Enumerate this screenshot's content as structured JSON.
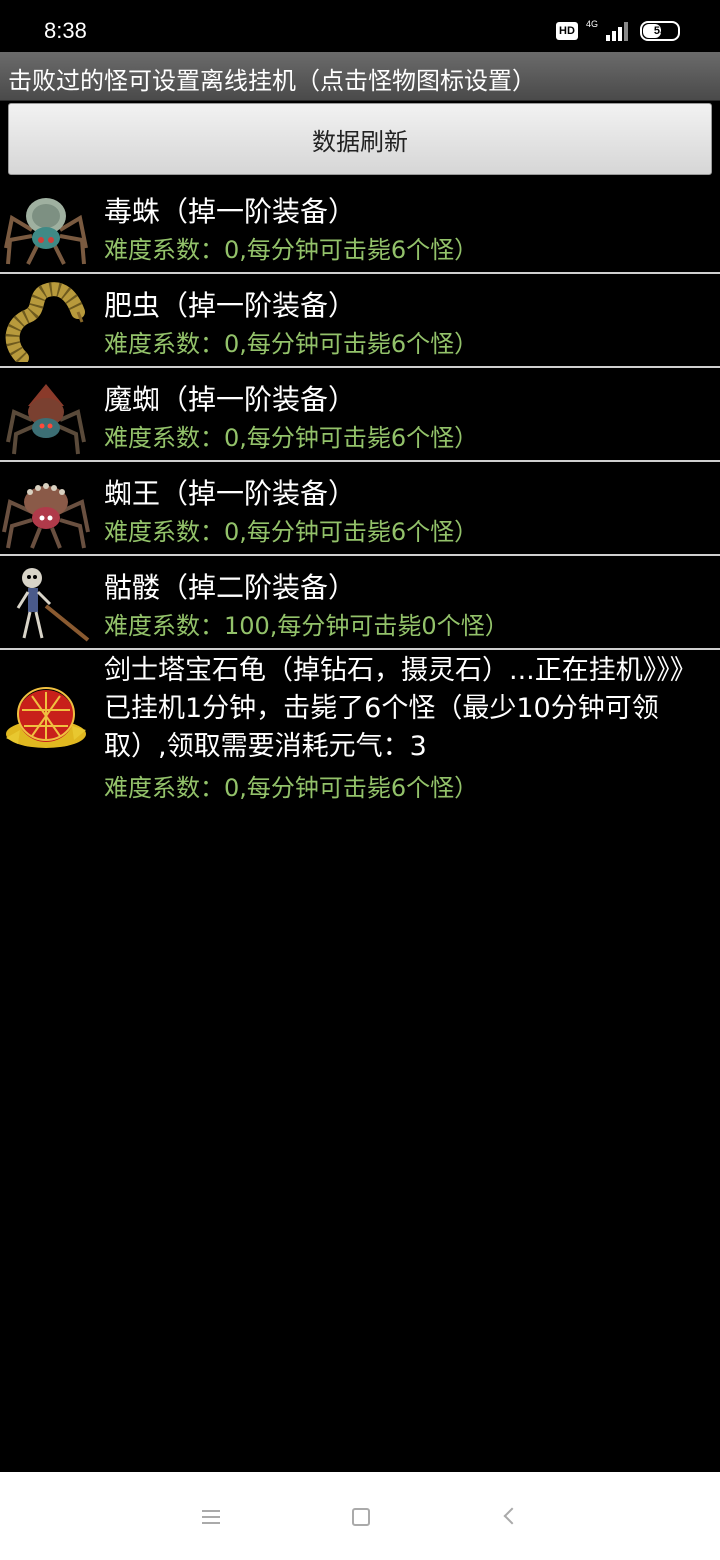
{
  "status_bar": {
    "time": "8:38",
    "hd_label": "HD",
    "network": "4G",
    "battery_level": "53",
    "icons": [
      "hd-icon",
      "signal-icon",
      "battery-icon"
    ]
  },
  "title": "击败过的怪可设置离线挂机（点击怪物图标设置）",
  "refresh_button": "数据刷新",
  "monsters": [
    {
      "name": "毒蛛（掉一阶装备）",
      "info": "难度系数：0,每分钟可击毙6个怪）",
      "icon": "spider-icon"
    },
    {
      "name": "肥虫（掉一阶装备）",
      "info": "难度系数：0,每分钟可击毙6个怪）",
      "icon": "worm-icon"
    },
    {
      "name": "魔蜘（掉一阶装备）",
      "info": "难度系数：0,每分钟可击毙6个怪）",
      "icon": "demon-spider-icon"
    },
    {
      "name": "蜘王（掉一阶装备）",
      "info": "难度系数：0,每分钟可击毙6个怪）",
      "icon": "spider-king-icon"
    },
    {
      "name": "骷髅（掉二阶装备）",
      "info": "难度系数：100,每分钟可击毙0个怪）",
      "icon": "skeleton-icon"
    },
    {
      "name": "剑士塔宝石龟（掉钻石，摄灵石）...正在挂机》》》已挂机1分钟，击毙了6个怪（最少10分钟可领取）,领取需要消耗元气：3",
      "info": "难度系数：0,每分钟可击毙6个怪）",
      "icon": "gem-turtle-icon"
    }
  ],
  "colors": {
    "info_text": "#93c26a",
    "title_bar": "#5a5a5a",
    "background": "#000000"
  },
  "nav_bar": {
    "icons": [
      "menu-icon",
      "home-icon",
      "back-icon"
    ]
  }
}
